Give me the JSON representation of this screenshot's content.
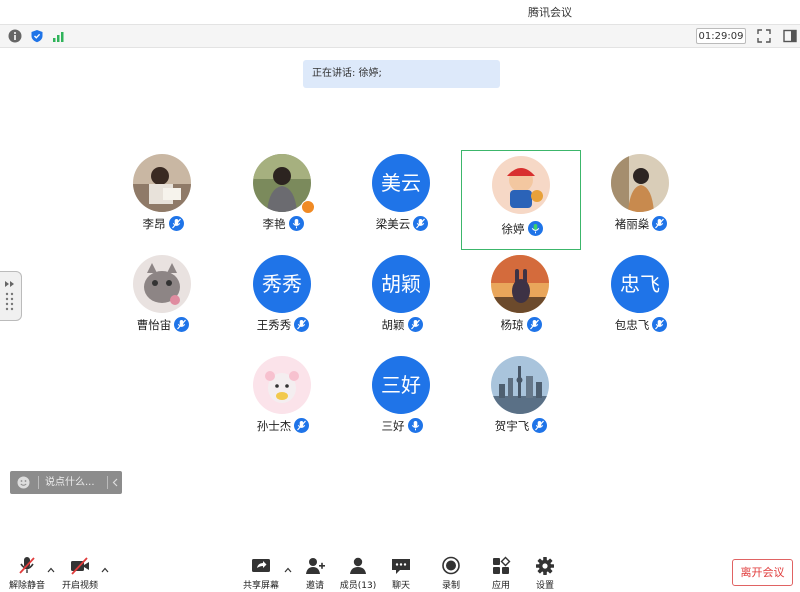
{
  "window": {
    "title": "腾讯会议"
  },
  "status": {
    "timer": "01:29:09"
  },
  "speaking": {
    "text": "正在讲话: 徐婷;"
  },
  "participants": [
    {
      "name": "李昂",
      "avatar": "photo-woman-reading"
    },
    {
      "name": "李艳",
      "avatar": "photo-woman-outdoor"
    },
    {
      "name": "梁美云",
      "avatar_text": "美云"
    },
    {
      "name": "徐婷",
      "avatar": "photo-cartoon-girl"
    },
    {
      "name": "褚丽燊",
      "avatar": "photo-woman-room"
    },
    {
      "name": "曹怡宙",
      "avatar": "photo-cat"
    },
    {
      "name": "王秀秀",
      "avatar_text": "秀秀"
    },
    {
      "name": "胡颖",
      "avatar_text": "胡颖"
    },
    {
      "name": "杨琼",
      "avatar": "photo-rabbit-sunset"
    },
    {
      "name": "包忠飞",
      "avatar_text": "忠飞"
    },
    {
      "name": "孙士杰",
      "avatar": "photo-toy-bear"
    },
    {
      "name": "三好",
      "avatar_text": "三好"
    },
    {
      "name": "贺宇飞",
      "avatar": "photo-city-skyline"
    }
  ],
  "chat": {
    "placeholder": "说点什么..."
  },
  "toolbar": {
    "unmute": "解除静音",
    "start_video": "开启视频",
    "share_screen": "共享屏幕",
    "invite": "邀请",
    "members": "成员(13)",
    "chat": "聊天",
    "record": "录制",
    "apps": "应用",
    "settings": "设置",
    "leave": "离开会议"
  },
  "colors": {
    "accent": "#1f74e8",
    "active_border": "#3cb66b",
    "leave": "#e03b3b"
  }
}
